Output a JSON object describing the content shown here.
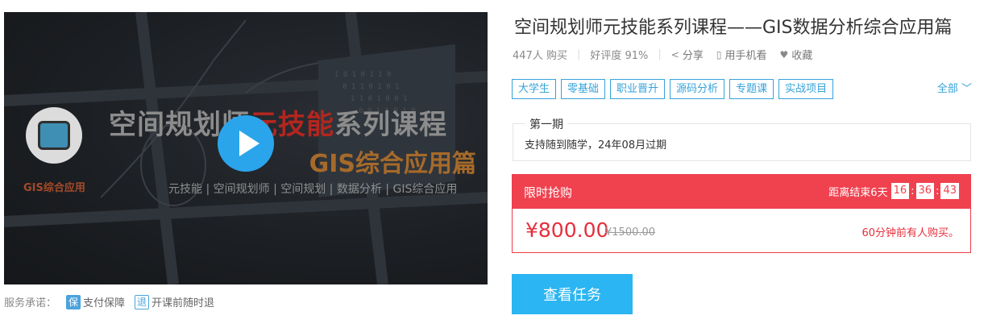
{
  "cover": {
    "title_pre": "空间规划师",
    "title_hl": "元技能",
    "title_post": "系列课程",
    "subtitle": "GIS综合应用篇",
    "logo_text": "GIS综合应用",
    "keywords": "元技能 | 空间规划师 | 空间规划 | 数据分析 | GIS综合应用"
  },
  "service": {
    "label": "服务承诺：",
    "items": [
      {
        "badge": "保",
        "label": "支付保障"
      },
      {
        "badge": "退",
        "label": "开课前随时退"
      }
    ]
  },
  "course": {
    "title": "空间规划师元技能系列课程——GIS数据分析综合应用篇",
    "buyers": "447人 购买",
    "rating": "好评度 91%",
    "share": "分享",
    "mobile": "用手机看",
    "favorite": "收藏"
  },
  "tags": [
    "大学生",
    "零基础",
    "职业晋升",
    "源码分析",
    "专题课",
    "实战项目"
  ],
  "tags_all": "全部",
  "period": {
    "legend": "第一期",
    "text": "支持随到随学，24年08月过期"
  },
  "flash_sale": {
    "label": "限时抢购",
    "countdown_prefix": "距离结束6天",
    "hours": "16",
    "minutes": "36",
    "seconds": "43",
    "price": "¥800.00",
    "original_price": "¥1500.00",
    "note": "60分钟前有人购买。"
  },
  "cta_label": "查看任务",
  "colors": {
    "accent_blue": "#2bb5f2",
    "sale_red": "#f0414f",
    "tag_blue": "#36a2da"
  }
}
